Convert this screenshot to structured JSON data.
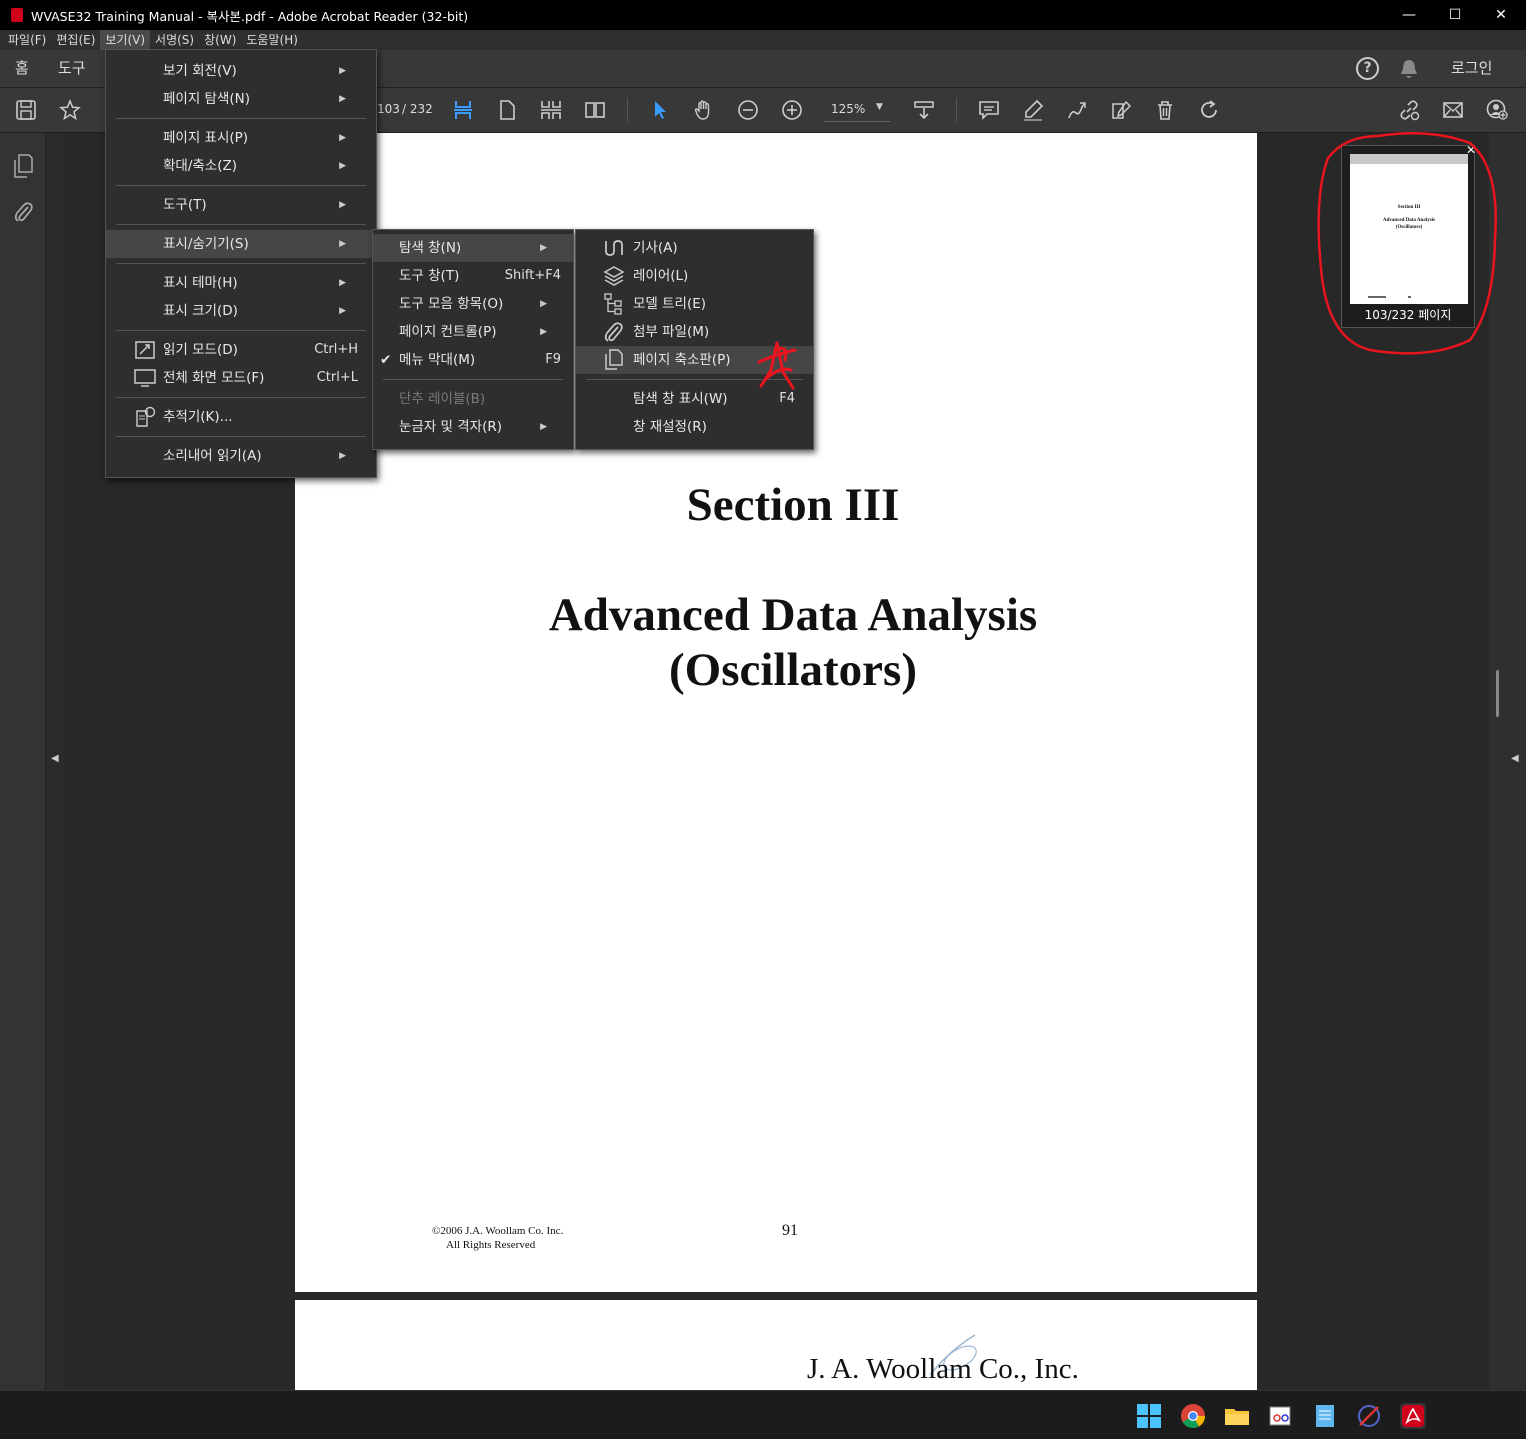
{
  "window": {
    "title": "WVASE32 Training Manual - 복사본.pdf - Adobe Acrobat Reader (32-bit)",
    "minimize": "—",
    "maximize": "☐",
    "close": "✕"
  },
  "menubar": {
    "items": [
      "파일(F)",
      "편집(E)",
      "보기(V)",
      "서명(S)",
      "창(W)",
      "도움말(H)"
    ]
  },
  "tabs": {
    "home": "홈",
    "tools": "도구",
    "signin": "로그인"
  },
  "toolbar": {
    "page_current": "103",
    "page_total": "/ 232",
    "zoom": "125%"
  },
  "view_menu": {
    "items": [
      {
        "label": "보기 회전(V)"
      },
      {
        "label": "페이지 탐색(N)"
      },
      {
        "label": "페이지 표시(P)"
      },
      {
        "label": "확대/축소(Z)"
      },
      {
        "label": "도구(T)"
      },
      {
        "label": "표시/숨기기(S)"
      },
      {
        "label": "표시 테마(H)"
      },
      {
        "label": "표시 크기(D)"
      },
      {
        "label": "읽기 모드(D)",
        "shortcut": "Ctrl+H"
      },
      {
        "label": "전체 화면 모드(F)",
        "shortcut": "Ctrl+L"
      },
      {
        "label": "추적기(K)..."
      },
      {
        "label": "소리내어 읽기(A)"
      }
    ]
  },
  "showhide_menu": {
    "items": [
      {
        "label": "탐색 창(N)"
      },
      {
        "label": "도구 창(T)",
        "shortcut": "Shift+F4"
      },
      {
        "label": "도구 모음 항목(O)"
      },
      {
        "label": "페이지 컨트롤(P)"
      },
      {
        "label": "메뉴 막대(M)",
        "shortcut": "F9",
        "checked": true
      },
      {
        "label": "단추 레이블(B)",
        "disabled": true
      },
      {
        "label": "눈금자 및 격자(R)"
      }
    ]
  },
  "navpane_menu": {
    "items": [
      {
        "label": "기사(A)",
        "icon": "article-icon"
      },
      {
        "label": "레이어(L)",
        "icon": "layers-icon"
      },
      {
        "label": "모델 트리(E)",
        "icon": "model-tree-icon"
      },
      {
        "label": "첨부 파일(M)",
        "icon": "paperclip-icon"
      },
      {
        "label": "페이지 축소판(P)",
        "icon": "page-thumbnails-icon"
      },
      {
        "label": "탐색 창 표시(W)",
        "shortcut": "F4"
      },
      {
        "label": "창 재설정(R)"
      }
    ]
  },
  "document": {
    "section": "Section III",
    "title_line1": "Advanced Data Analysis",
    "title_line2": "(Oscillators)",
    "copyright_line1": "©2006  J.A. Woollam Co. Inc.",
    "copyright_line2": "All Rights Reserved",
    "page_number": "91",
    "next_page_header": "J. A. Woollam Co., Inc."
  },
  "thumbnail_popup": {
    "label": "103/232 페이지",
    "close": "✕",
    "mini_section": "Section III",
    "mini_title1": "Advanced Data Analysis",
    "mini_title2": "(Oscillators)"
  },
  "colors": {
    "annotation_red": "#e8141e",
    "accent_blue": "#3b9cff"
  }
}
